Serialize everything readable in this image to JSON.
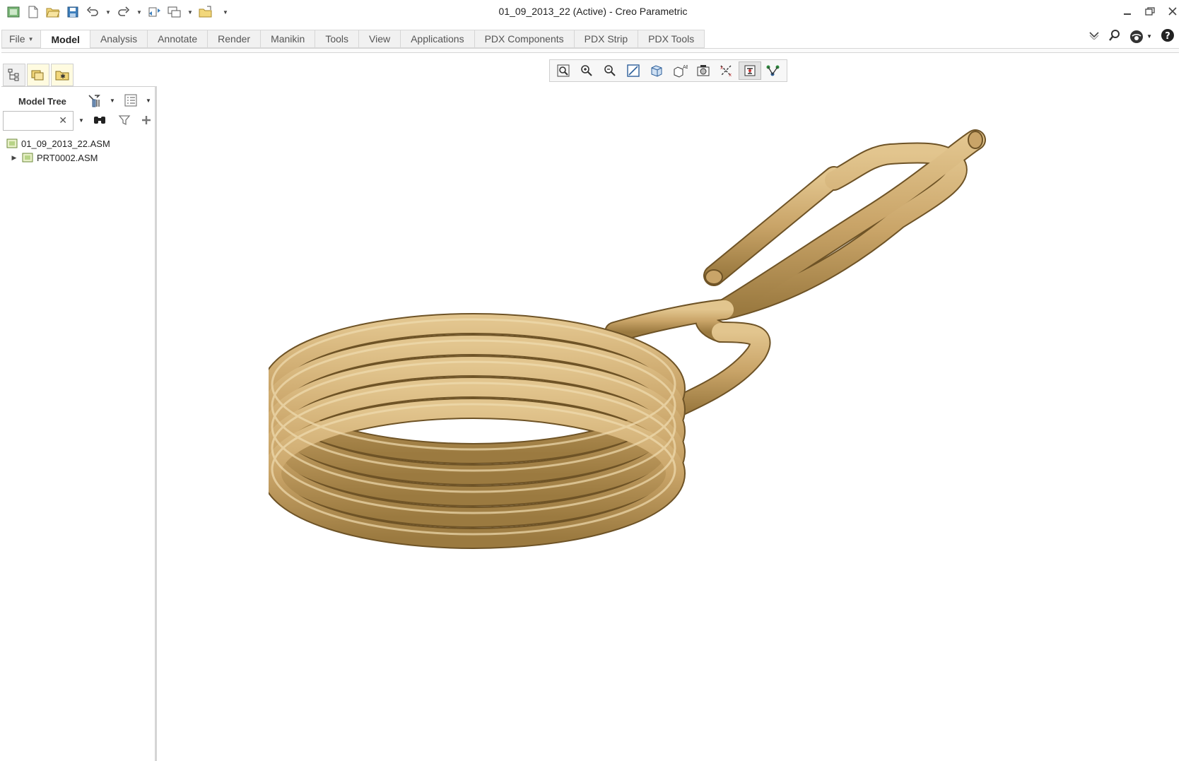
{
  "window": {
    "title": "01_09_2013_22 (Active) - Creo Parametric"
  },
  "quick_access": {
    "icons": [
      "app-icon",
      "new-icon",
      "open-icon",
      "save-icon",
      "undo-icon",
      "redo-icon",
      "regenerate-icon",
      "windows-icon",
      "close-window-icon",
      "customize-icon"
    ]
  },
  "ribbon": {
    "tabs": [
      {
        "label": "File",
        "active": false
      },
      {
        "label": "Model",
        "active": true
      },
      {
        "label": "Analysis",
        "active": false
      },
      {
        "label": "Annotate",
        "active": false
      },
      {
        "label": "Render",
        "active": false
      },
      {
        "label": "Manikin",
        "active": false
      },
      {
        "label": "Tools",
        "active": false
      },
      {
        "label": "View",
        "active": false
      },
      {
        "label": "Applications",
        "active": false
      },
      {
        "label": "PDX Components",
        "active": false
      },
      {
        "label": "PDX Strip",
        "active": false
      },
      {
        "label": "PDX Tools",
        "active": false
      }
    ]
  },
  "navigator": {
    "title": "Model Tree",
    "search_value": "",
    "tree": [
      {
        "label": "01_09_2013_22.ASM",
        "level": 0,
        "expandable": false
      },
      {
        "label": "PRT0002.ASM",
        "level": 1,
        "expandable": true
      }
    ]
  },
  "graphics_toolbar": {
    "icons": [
      "refit-icon",
      "zoom-in-icon",
      "zoom-out-icon",
      "repaint-icon",
      "display-style-icon",
      "saved-orientations-icon",
      "view-manager-icon",
      "datum-display-icon",
      "spin-center-icon",
      "annotation-display-icon"
    ],
    "active_index": 8
  },
  "colors": {
    "coil": "#c9a468",
    "coil_dark": "#8e6d35",
    "coil_light": "#e2c58e"
  }
}
